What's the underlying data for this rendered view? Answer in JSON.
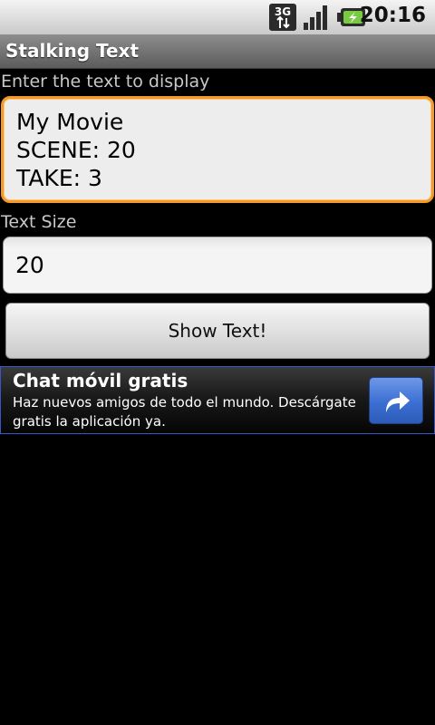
{
  "status_bar": {
    "time": "20:16",
    "network_label": "3G",
    "icons": [
      "3g-data-icon",
      "signal-strength-icon",
      "battery-charging-icon"
    ]
  },
  "app": {
    "title": "Stalking Text"
  },
  "form": {
    "text_label": "Enter the text to display",
    "text_value": "My Movie\nSCENE: 20\nTAKE: 3",
    "size_label": "Text Size",
    "size_value": "20",
    "show_button_label": "Show Text!"
  },
  "ad": {
    "title": "Chat móvil gratis",
    "body": "Haz nuevos amigos de todo el mundo. Descárgate gratis la aplicación ya.",
    "button_icon": "share-arrow-icon"
  },
  "colors": {
    "focus_border": "#f39a2a",
    "ad_border": "#3b55c8",
    "ad_button": "#3b6fd2"
  }
}
